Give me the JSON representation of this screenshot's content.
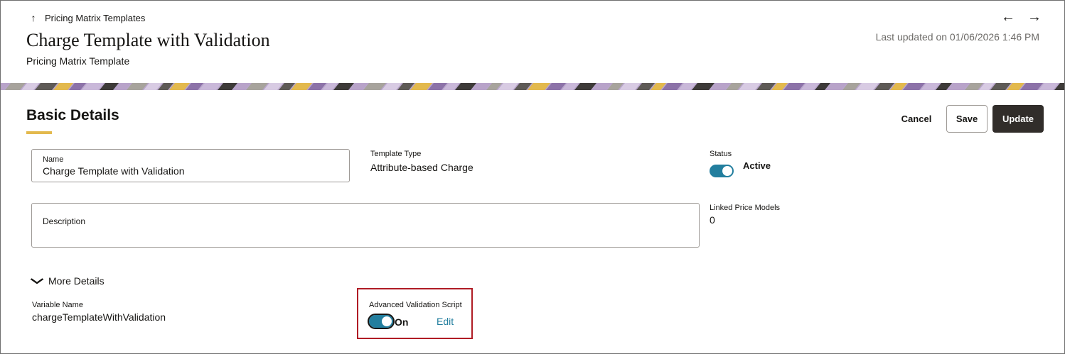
{
  "header": {
    "breadcrumb_label": "Pricing Matrix Templates",
    "title": "Charge Template with Validation",
    "subtitle": "Pricing Matrix Template",
    "last_updated": "Last updated on 01/06/2026 1:46 PM",
    "nav_prev_icon": "←",
    "nav_next_icon": "→",
    "up_icon": "↑"
  },
  "section": {
    "title": "Basic Details"
  },
  "actions": {
    "cancel_label": "Cancel",
    "save_label": "Save",
    "update_label": "Update"
  },
  "fields": {
    "name": {
      "label": "Name",
      "value": "Charge Template with Validation"
    },
    "template_type": {
      "label": "Template Type",
      "value": "Attribute-based Charge"
    },
    "status": {
      "label": "Status",
      "value": "Active",
      "enabled": true
    },
    "description": {
      "label": "Description",
      "value": ""
    },
    "linked_price_models": {
      "label": "Linked Price Models",
      "value": "0"
    }
  },
  "more_details": {
    "toggle_label": "More Details",
    "chevron_icon": "⌄",
    "variable_name": {
      "label": "Variable Name",
      "value": "chargeTemplateWithValidation"
    },
    "advanced_validation_script": {
      "label": "Advanced Validation Script",
      "value": "On",
      "enabled": true,
      "edit_label": "Edit"
    }
  },
  "colors": {
    "accent": "#227e9e",
    "underline": "#e3b94d",
    "primary_button": "#312d2a",
    "highlight": "#b01c25"
  }
}
